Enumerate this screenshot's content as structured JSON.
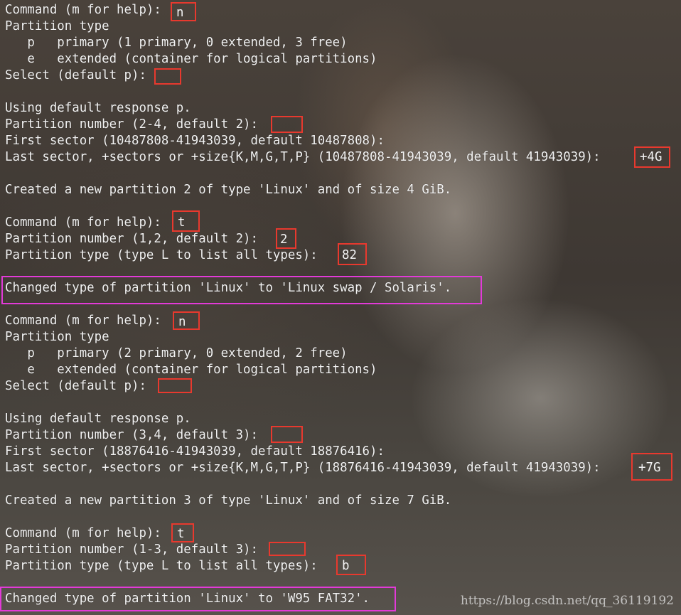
{
  "terminal": {
    "lines": [
      "Command (m for help): ",
      "Partition type",
      "   p   primary (1 primary, 0 extended, 3 free)",
      "   e   extended (container for logical partitions)",
      "Select (default p): ",
      "",
      "Using default response p.",
      "Partition number (2-4, default 2): ",
      "First sector (10487808-41943039, default 10487808):",
      "Last sector, +sectors or +size{K,M,G,T,P} (10487808-41943039, default 41943039): ",
      "",
      "Created a new partition 2 of type 'Linux' and of size 4 GiB.",
      "",
      "Command (m for help): ",
      "Partition number (1,2, default 2): ",
      "Partition type (type L to list all types): ",
      "",
      "Changed type of partition 'Linux' to 'Linux swap / Solaris'.",
      "",
      "Command (m for help): ",
      "Partition type",
      "   p   primary (2 primary, 0 extended, 2 free)",
      "   e   extended (container for logical partitions)",
      "Select (default p): ",
      "",
      "Using default response p.",
      "Partition number (3,4, default 3): ",
      "First sector (18876416-41943039, default 18876416):",
      "Last sector, +sectors or +size{K,M,G,T,P} (18876416-41943039, default 41943039): ",
      "",
      "Created a new partition 3 of type 'Linux' and of size 7 GiB.",
      "",
      "Command (m for help): ",
      "Partition number (1-3, default 3): ",
      "Partition type (type L to list all types): ",
      "",
      "Changed type of partition 'Linux' to 'W95 FAT32'."
    ],
    "inputs": [
      "n",
      "",
      "",
      "+4G",
      "t",
      "2",
      "82",
      "n",
      "",
      "",
      "+7G",
      "t",
      "",
      "b"
    ]
  },
  "watermark": "https://blog.csdn.net/qq_36119192",
  "colors": {
    "input_highlight": "#e8392e",
    "result_highlight": "#e23ad8",
    "text": "#f2f2f2"
  }
}
